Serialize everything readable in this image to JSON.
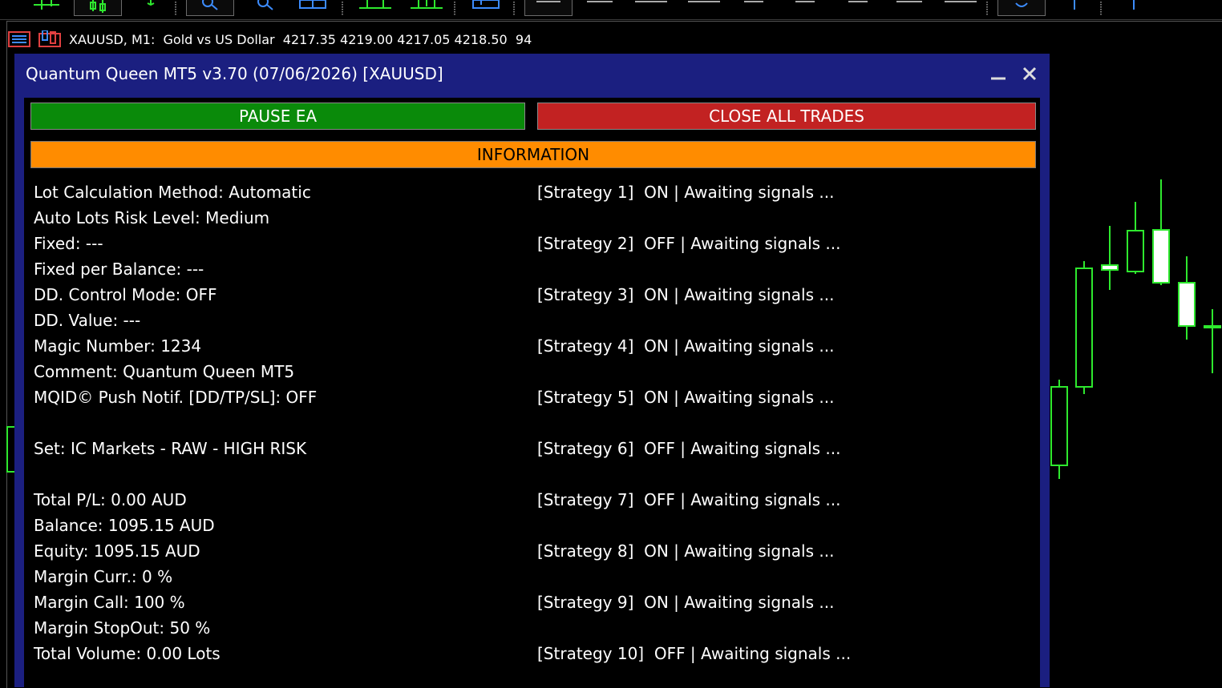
{
  "chart": {
    "header_text": "XAUUSD, M1:  Gold vs US Dollar  4217.35 4219.00 4217.05 4218.50  94",
    "candle_color": "#2ee82e"
  },
  "panel": {
    "title": "Quantum Queen MT5 v3.70 (07/06/2026) [XAUUSD]",
    "pause_label": "PAUSE EA",
    "close_all_label": "CLOSE ALL TRADES",
    "info_label": "INFORMATION",
    "colors": {
      "pause": "#0a8a0a",
      "close": "#c22222",
      "info": "#ff8c00",
      "frame": "#1b1f80"
    },
    "left_info": [
      "Lot Calculation Method: Automatic",
      "Auto Lots Risk Level: Medium",
      "Fixed: ---",
      "Fixed per Balance: ---",
      "DD. Control Mode: OFF",
      "DD. Value: ---",
      "Magic Number: 1234",
      "Comment: Quantum Queen MT5",
      "MQID© Push Notif. [DD/TP/SL]: OFF",
      "",
      "Set: IC Markets - RAW - HIGH RISK",
      "",
      "Total P/L: 0.00 AUD",
      "Balance: 1095.15 AUD",
      "Equity: 1095.15 AUD",
      "Margin Curr.: 0 %",
      "Margin Call: 100 %",
      "Margin StopOut: 50 %",
      "Total Volume: 0.00 Lots"
    ],
    "strategies": [
      "[Strategy 1]  ON | Awaiting signals ...",
      "[Strategy 2]  OFF | Awaiting signals ...",
      "[Strategy 3]  ON | Awaiting signals ...",
      "[Strategy 4]  ON | Awaiting signals ...",
      "[Strategy 5]  ON | Awaiting signals ...",
      "[Strategy 6]  OFF | Awaiting signals ...",
      "[Strategy 7]  OFF | Awaiting signals ...",
      "[Strategy 8]  ON | Awaiting signals ...",
      "[Strategy 9]  ON | Awaiting signals ...",
      "[Strategy 10]  OFF | Awaiting signals ..."
    ]
  }
}
